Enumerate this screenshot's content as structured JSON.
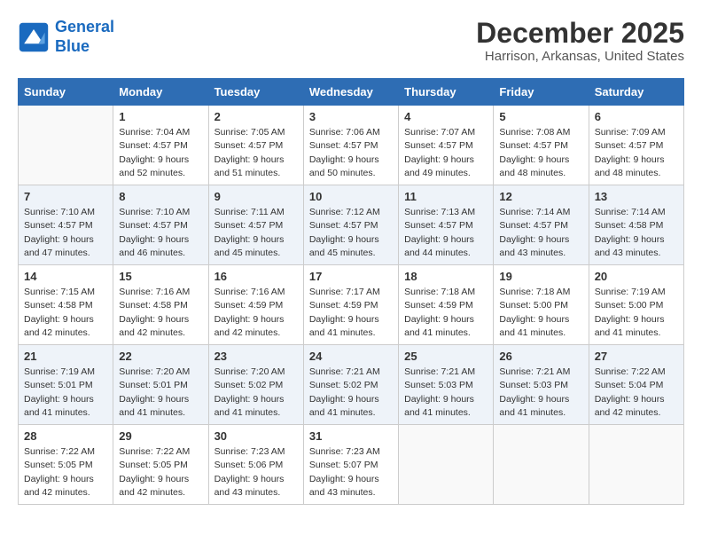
{
  "logo": {
    "line1": "General",
    "line2": "Blue"
  },
  "calendar": {
    "title": "December 2025",
    "subtitle": "Harrison, Arkansas, United States"
  },
  "headers": [
    "Sunday",
    "Monday",
    "Tuesday",
    "Wednesday",
    "Thursday",
    "Friday",
    "Saturday"
  ],
  "weeks": [
    [
      {
        "day": "",
        "sunrise": "",
        "sunset": "",
        "daylight": ""
      },
      {
        "day": "1",
        "sunrise": "Sunrise: 7:04 AM",
        "sunset": "Sunset: 4:57 PM",
        "daylight": "Daylight: 9 hours and 52 minutes."
      },
      {
        "day": "2",
        "sunrise": "Sunrise: 7:05 AM",
        "sunset": "Sunset: 4:57 PM",
        "daylight": "Daylight: 9 hours and 51 minutes."
      },
      {
        "day": "3",
        "sunrise": "Sunrise: 7:06 AM",
        "sunset": "Sunset: 4:57 PM",
        "daylight": "Daylight: 9 hours and 50 minutes."
      },
      {
        "day": "4",
        "sunrise": "Sunrise: 7:07 AM",
        "sunset": "Sunset: 4:57 PM",
        "daylight": "Daylight: 9 hours and 49 minutes."
      },
      {
        "day": "5",
        "sunrise": "Sunrise: 7:08 AM",
        "sunset": "Sunset: 4:57 PM",
        "daylight": "Daylight: 9 hours and 48 minutes."
      },
      {
        "day": "6",
        "sunrise": "Sunrise: 7:09 AM",
        "sunset": "Sunset: 4:57 PM",
        "daylight": "Daylight: 9 hours and 48 minutes."
      }
    ],
    [
      {
        "day": "7",
        "sunrise": "Sunrise: 7:10 AM",
        "sunset": "Sunset: 4:57 PM",
        "daylight": "Daylight: 9 hours and 47 minutes."
      },
      {
        "day": "8",
        "sunrise": "Sunrise: 7:10 AM",
        "sunset": "Sunset: 4:57 PM",
        "daylight": "Daylight: 9 hours and 46 minutes."
      },
      {
        "day": "9",
        "sunrise": "Sunrise: 7:11 AM",
        "sunset": "Sunset: 4:57 PM",
        "daylight": "Daylight: 9 hours and 45 minutes."
      },
      {
        "day": "10",
        "sunrise": "Sunrise: 7:12 AM",
        "sunset": "Sunset: 4:57 PM",
        "daylight": "Daylight: 9 hours and 45 minutes."
      },
      {
        "day": "11",
        "sunrise": "Sunrise: 7:13 AM",
        "sunset": "Sunset: 4:57 PM",
        "daylight": "Daylight: 9 hours and 44 minutes."
      },
      {
        "day": "12",
        "sunrise": "Sunrise: 7:14 AM",
        "sunset": "Sunset: 4:57 PM",
        "daylight": "Daylight: 9 hours and 43 minutes."
      },
      {
        "day": "13",
        "sunrise": "Sunrise: 7:14 AM",
        "sunset": "Sunset: 4:58 PM",
        "daylight": "Daylight: 9 hours and 43 minutes."
      }
    ],
    [
      {
        "day": "14",
        "sunrise": "Sunrise: 7:15 AM",
        "sunset": "Sunset: 4:58 PM",
        "daylight": "Daylight: 9 hours and 42 minutes."
      },
      {
        "day": "15",
        "sunrise": "Sunrise: 7:16 AM",
        "sunset": "Sunset: 4:58 PM",
        "daylight": "Daylight: 9 hours and 42 minutes."
      },
      {
        "day": "16",
        "sunrise": "Sunrise: 7:16 AM",
        "sunset": "Sunset: 4:59 PM",
        "daylight": "Daylight: 9 hours and 42 minutes."
      },
      {
        "day": "17",
        "sunrise": "Sunrise: 7:17 AM",
        "sunset": "Sunset: 4:59 PM",
        "daylight": "Daylight: 9 hours and 41 minutes."
      },
      {
        "day": "18",
        "sunrise": "Sunrise: 7:18 AM",
        "sunset": "Sunset: 4:59 PM",
        "daylight": "Daylight: 9 hours and 41 minutes."
      },
      {
        "day": "19",
        "sunrise": "Sunrise: 7:18 AM",
        "sunset": "Sunset: 5:00 PM",
        "daylight": "Daylight: 9 hours and 41 minutes."
      },
      {
        "day": "20",
        "sunrise": "Sunrise: 7:19 AM",
        "sunset": "Sunset: 5:00 PM",
        "daylight": "Daylight: 9 hours and 41 minutes."
      }
    ],
    [
      {
        "day": "21",
        "sunrise": "Sunrise: 7:19 AM",
        "sunset": "Sunset: 5:01 PM",
        "daylight": "Daylight: 9 hours and 41 minutes."
      },
      {
        "day": "22",
        "sunrise": "Sunrise: 7:20 AM",
        "sunset": "Sunset: 5:01 PM",
        "daylight": "Daylight: 9 hours and 41 minutes."
      },
      {
        "day": "23",
        "sunrise": "Sunrise: 7:20 AM",
        "sunset": "Sunset: 5:02 PM",
        "daylight": "Daylight: 9 hours and 41 minutes."
      },
      {
        "day": "24",
        "sunrise": "Sunrise: 7:21 AM",
        "sunset": "Sunset: 5:02 PM",
        "daylight": "Daylight: 9 hours and 41 minutes."
      },
      {
        "day": "25",
        "sunrise": "Sunrise: 7:21 AM",
        "sunset": "Sunset: 5:03 PM",
        "daylight": "Daylight: 9 hours and 41 minutes."
      },
      {
        "day": "26",
        "sunrise": "Sunrise: 7:21 AM",
        "sunset": "Sunset: 5:03 PM",
        "daylight": "Daylight: 9 hours and 41 minutes."
      },
      {
        "day": "27",
        "sunrise": "Sunrise: 7:22 AM",
        "sunset": "Sunset: 5:04 PM",
        "daylight": "Daylight: 9 hours and 42 minutes."
      }
    ],
    [
      {
        "day": "28",
        "sunrise": "Sunrise: 7:22 AM",
        "sunset": "Sunset: 5:05 PM",
        "daylight": "Daylight: 9 hours and 42 minutes."
      },
      {
        "day": "29",
        "sunrise": "Sunrise: 7:22 AM",
        "sunset": "Sunset: 5:05 PM",
        "daylight": "Daylight: 9 hours and 42 minutes."
      },
      {
        "day": "30",
        "sunrise": "Sunrise: 7:23 AM",
        "sunset": "Sunset: 5:06 PM",
        "daylight": "Daylight: 9 hours and 43 minutes."
      },
      {
        "day": "31",
        "sunrise": "Sunrise: 7:23 AM",
        "sunset": "Sunset: 5:07 PM",
        "daylight": "Daylight: 9 hours and 43 minutes."
      },
      {
        "day": "",
        "sunrise": "",
        "sunset": "",
        "daylight": ""
      },
      {
        "day": "",
        "sunrise": "",
        "sunset": "",
        "daylight": ""
      },
      {
        "day": "",
        "sunrise": "",
        "sunset": "",
        "daylight": ""
      }
    ]
  ]
}
